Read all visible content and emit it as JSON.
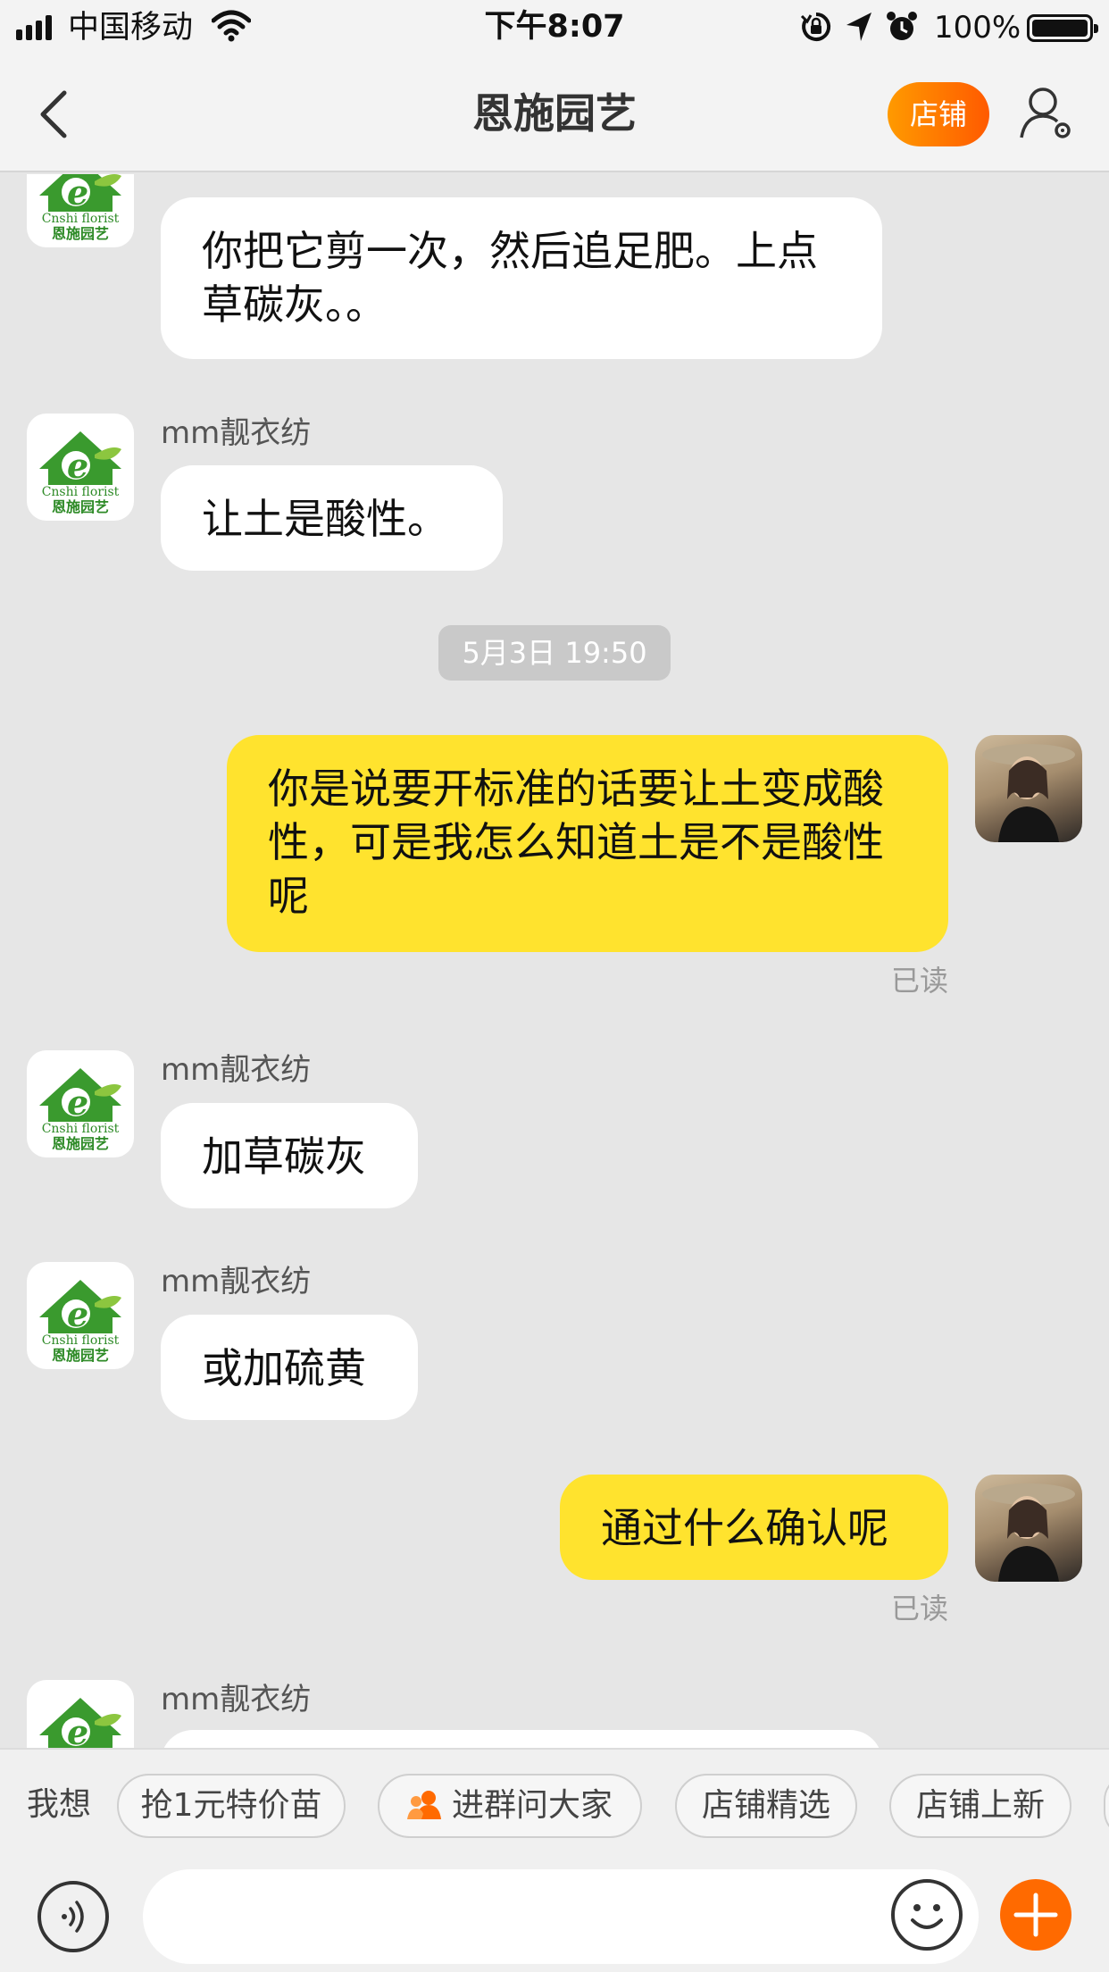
{
  "status_bar": {
    "carrier": "中国移动",
    "time": "下午8:07",
    "battery": "100%",
    "icons": [
      "signal-icon",
      "wifi-icon",
      "rotation-lock-icon",
      "location-icon",
      "alarm-icon",
      "battery-icon"
    ]
  },
  "nav": {
    "back_icon": "chevron-left-icon",
    "title": "恩施园艺",
    "shop_button": "店铺",
    "profile_icon": "user-settings-icon"
  },
  "shop": {
    "logo_caption": "Cnshi florist",
    "logo_caption_cn": "恩施园艺"
  },
  "messages": {
    "m0": {
      "text": "你把它剪一次，然后追足肥。上点草碳灰。。"
    },
    "m1": {
      "sender": "mm靓衣纺",
      "text": "让土是酸性。"
    },
    "ts": "5月3日 19:50",
    "m2": {
      "text": "你是说要开标准的话要让土变成酸性，可是我怎么知道土是不是酸性呢",
      "status": "已读"
    },
    "m3": {
      "sender": "mm靓衣纺",
      "text": "加草碳灰"
    },
    "m4": {
      "sender": "mm靓衣纺",
      "text": "或加硫黄"
    },
    "m5": {
      "text": "通过什么确认呢",
      "status": "已读"
    },
    "m6": {
      "sender": "mm靓衣纺"
    }
  },
  "quick_replies": {
    "label": "我想",
    "chips": [
      "抢1元特价苗",
      "进群问大家",
      "店铺精选",
      "店铺上新"
    ]
  },
  "input_bar": {
    "voice_icon": "voice-icon",
    "placeholder": "",
    "emoji_icon": "emoji-icon",
    "plus_icon": "plus-icon"
  },
  "colors": {
    "accent": "#ff6a00",
    "outgoing_bubble": "#ffe32e",
    "incoming_bubble": "#ffffff",
    "background": "#e6e6e6",
    "logo_green": "#2d8a26"
  }
}
